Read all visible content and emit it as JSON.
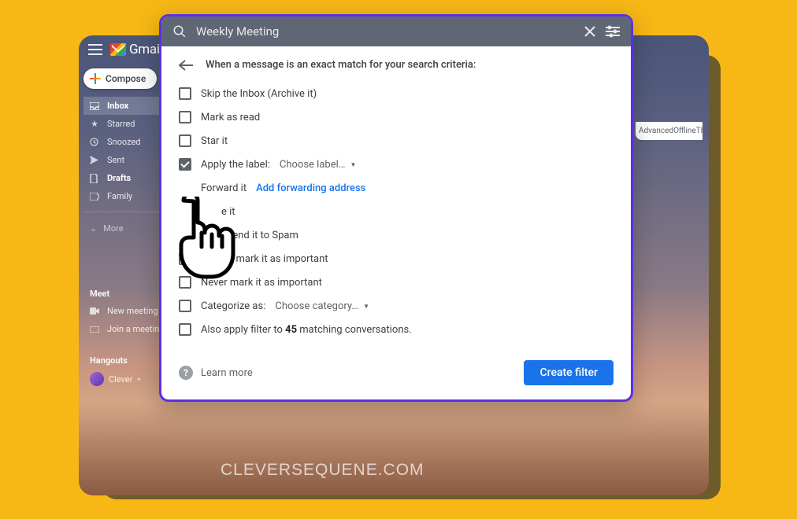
{
  "gmail": {
    "brand": "Gmail",
    "compose": "Compose",
    "nav": {
      "inbox": "Inbox",
      "starred": "Starred",
      "snoozed": "Snoozed",
      "sent": "Sent",
      "drafts": "Drafts",
      "family": "Family",
      "more": "More"
    },
    "meet": {
      "label": "Meet",
      "new": "New meeting",
      "join": "Join a meeting"
    },
    "hangouts": {
      "label": "Hangouts",
      "user": "Clever"
    },
    "tabs": {
      "advanced": "Advanced",
      "offline": "Offline",
      "themes": "Th"
    }
  },
  "dialog": {
    "search_value": "Weekly Meeting",
    "heading": "When a message is an exact match for your search criteria:",
    "rows": {
      "skip_inbox": "Skip the Inbox (Archive it)",
      "mark_read": "Mark as read",
      "star": "Star it",
      "apply_label": "Apply the label:",
      "choose_label": "Choose label…",
      "forward": "Forward it",
      "add_forwarding": "Add forwarding address",
      "delete": "e it",
      "spam": "r send it to Spam",
      "important": "Always mark it as important",
      "not_important": "Never mark it as important",
      "categorize": "Categorize as:",
      "choose_category": "Choose category…",
      "also_apply_prefix": "Also apply filter to ",
      "also_apply_count": "45",
      "also_apply_suffix": " matching conversations."
    },
    "learn_more": "Learn more",
    "create_filter": "Create filter"
  },
  "watermark": "CLEVERSEQUENE.COM"
}
